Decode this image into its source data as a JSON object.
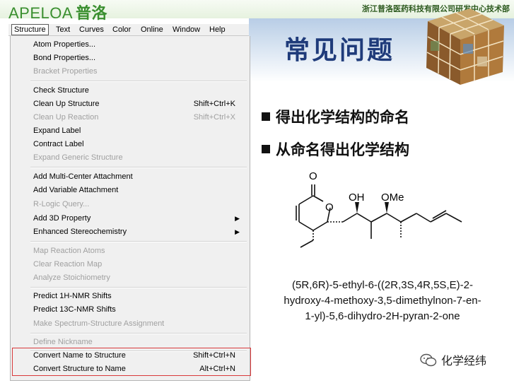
{
  "header": {
    "brand_latin": "APELOA",
    "brand_cn": "普洛",
    "department": "浙江普洛医药科技有限公司研发中心技术部"
  },
  "slide": {
    "title": "常见问题",
    "bullets": [
      "得出化学结构的命名",
      "从命名得出化学结构"
    ],
    "molecule_labels": {
      "carbonyl_o": "O",
      "ring_o": "O",
      "hydroxy": "OH",
      "methoxy": "OMe"
    },
    "iupac_name": [
      "(5R,6R)-5-ethyl-6-((2R,3S,4R,5S,E)-2-",
      "hydroxy-4-methoxy-3,5-dimethylnon-7-en-",
      "1-yl)-5,6-dihydro-2H-pyran-2-one"
    ],
    "watermark": "化学经纬"
  },
  "menubar": {
    "items": [
      "Structure",
      "Text",
      "Curves",
      "Color",
      "Online",
      "Window",
      "Help"
    ],
    "open_item": "Structure"
  },
  "dropdown": {
    "items": [
      {
        "label": "Atom Properties...",
        "shortcut": "",
        "disabled": false,
        "submenu": false
      },
      {
        "label": "Bond Properties...",
        "shortcut": "",
        "disabled": false,
        "submenu": false
      },
      {
        "label": "Bracket Properties",
        "shortcut": "",
        "disabled": true,
        "submenu": false
      },
      {
        "label": "Check Structure",
        "shortcut": "",
        "disabled": false,
        "submenu": false
      },
      {
        "label": "Clean Up Structure",
        "shortcut": "Shift+Ctrl+K",
        "disabled": false,
        "submenu": false
      },
      {
        "label": "Clean Up Reaction",
        "shortcut": "Shift+Ctrl+X",
        "disabled": true,
        "submenu": false
      },
      {
        "label": "Expand Label",
        "shortcut": "",
        "disabled": false,
        "submenu": false
      },
      {
        "label": "Contract Label",
        "shortcut": "",
        "disabled": false,
        "submenu": false
      },
      {
        "label": "Expand Generic Structure",
        "shortcut": "",
        "disabled": true,
        "submenu": false
      },
      {
        "label": "Add Multi-Center Attachment",
        "shortcut": "",
        "disabled": false,
        "submenu": false
      },
      {
        "label": "Add Variable Attachment",
        "shortcut": "",
        "disabled": false,
        "submenu": false
      },
      {
        "label": "R-Logic Query...",
        "shortcut": "",
        "disabled": true,
        "submenu": false
      },
      {
        "label": "Add 3D Property",
        "shortcut": "",
        "disabled": false,
        "submenu": true
      },
      {
        "label": "Enhanced Stereochemistry",
        "shortcut": "",
        "disabled": false,
        "submenu": true
      },
      {
        "label": "Map Reaction Atoms",
        "shortcut": "",
        "disabled": true,
        "submenu": false
      },
      {
        "label": "Clear Reaction Map",
        "shortcut": "",
        "disabled": true,
        "submenu": false
      },
      {
        "label": "Analyze Stoichiometry",
        "shortcut": "",
        "disabled": true,
        "submenu": false
      },
      {
        "label": "Predict 1H-NMR Shifts",
        "shortcut": "",
        "disabled": false,
        "submenu": false
      },
      {
        "label": "Predict 13C-NMR Shifts",
        "shortcut": "",
        "disabled": false,
        "submenu": false
      },
      {
        "label": "Make Spectrum-Structure Assignment",
        "shortcut": "",
        "disabled": true,
        "submenu": false
      },
      {
        "label": "Define Nickname",
        "shortcut": "",
        "disabled": true,
        "submenu": false
      },
      {
        "label": "Convert Name to Structure",
        "shortcut": "Shift+Ctrl+N",
        "disabled": false,
        "submenu": false
      },
      {
        "label": "Convert Structure to Name",
        "shortcut": "Alt+Ctrl+N",
        "disabled": false,
        "submenu": false
      }
    ]
  },
  "colors": {
    "title_blue": "#1f3b7a",
    "brand_green": "#3a8f2f",
    "highlight_red": "#d9393b"
  }
}
